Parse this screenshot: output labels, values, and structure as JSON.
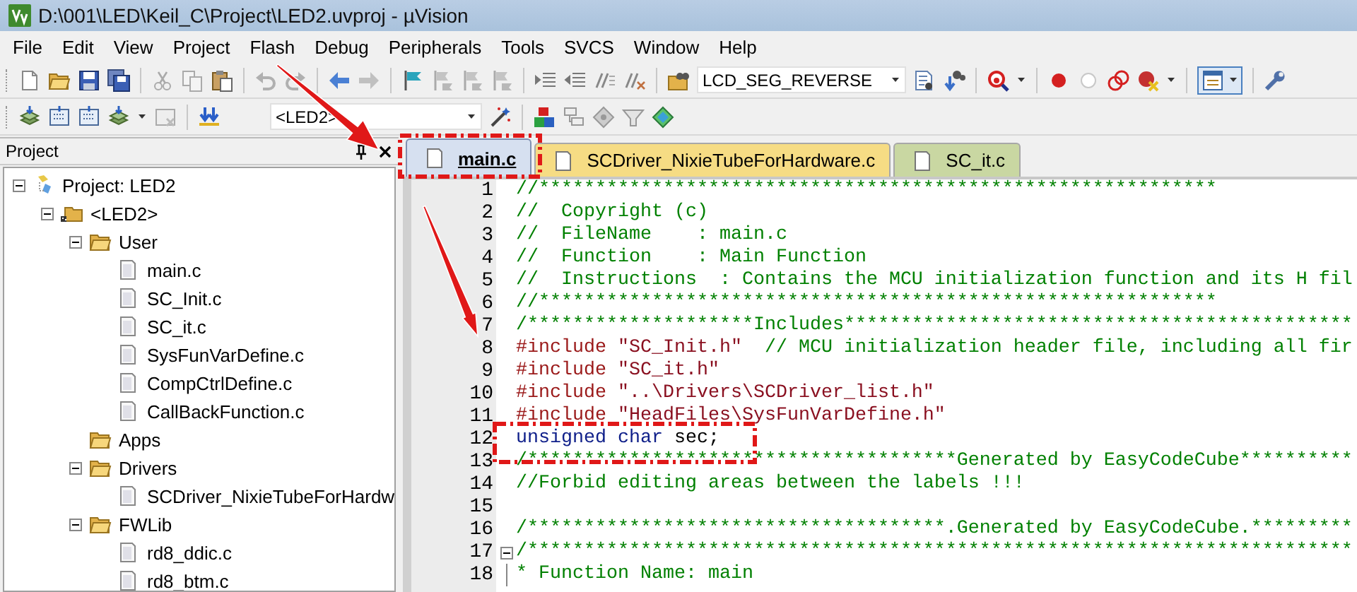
{
  "window": {
    "title": "D:\\001\\LED\\Keil_C\\Project\\LED2.uvproj - µVision"
  },
  "menu": [
    "File",
    "Edit",
    "View",
    "Project",
    "Flash",
    "Debug",
    "Peripherals",
    "Tools",
    "SVCS",
    "Window",
    "Help"
  ],
  "toolbar": {
    "find_combo": "LCD_SEG_REVERSE",
    "target_combo": "<LED2>"
  },
  "project_panel": {
    "title": "Project",
    "tree": [
      {
        "label": "Project: LED2",
        "kind": "project",
        "expanded": true,
        "children": [
          {
            "label": "<LED2>",
            "kind": "target",
            "expanded": true,
            "children": [
              {
                "label": "User",
                "kind": "group",
                "expanded": true,
                "children": [
                  {
                    "label": "main.c",
                    "kind": "file"
                  },
                  {
                    "label": "SC_Init.c",
                    "kind": "file"
                  },
                  {
                    "label": "SC_it.c",
                    "kind": "file"
                  },
                  {
                    "label": "SysFunVarDefine.c",
                    "kind": "file"
                  },
                  {
                    "label": "CompCtrlDefine.c",
                    "kind": "file"
                  },
                  {
                    "label": "CallBackFunction.c",
                    "kind": "file"
                  }
                ]
              },
              {
                "label": "Apps",
                "kind": "group"
              },
              {
                "label": "Drivers",
                "kind": "group",
                "expanded": true,
                "children": [
                  {
                    "label": "SCDriver_NixieTubeForHardw",
                    "kind": "file"
                  }
                ]
              },
              {
                "label": "FWLib",
                "kind": "group",
                "expanded": true,
                "children": [
                  {
                    "label": "rd8_ddic.c",
                    "kind": "file"
                  },
                  {
                    "label": "rd8_btm.c",
                    "kind": "file"
                  }
                ]
              }
            ]
          }
        ]
      }
    ]
  },
  "editor": {
    "tabs": [
      {
        "label": "main.c",
        "selected": true,
        "color": "#d6e0f0"
      },
      {
        "label": "SCDriver_NixieTubeForHardware.c",
        "selected": false,
        "color": "#f6dc84"
      },
      {
        "label": "SC_it.c",
        "selected": false,
        "color": "#c9d7a2"
      }
    ],
    "lines": [
      {
        "number": "1",
        "fold": false,
        "tokens": [
          {
            "kind": "comment",
            "text": "//************************************************************"
          }
        ]
      },
      {
        "number": "2",
        "fold": false,
        "tokens": [
          {
            "kind": "comment",
            "text": "//  Copyright (c)"
          }
        ]
      },
      {
        "number": "3",
        "fold": false,
        "tokens": [
          {
            "kind": "comment",
            "text": "//  FileName    : main.c"
          }
        ]
      },
      {
        "number": "4",
        "fold": false,
        "tokens": [
          {
            "kind": "comment",
            "text": "//  Function    : Main Function"
          }
        ]
      },
      {
        "number": "5",
        "fold": false,
        "tokens": [
          {
            "kind": "comment",
            "text": "//  Instructions  : Contains the MCU initialization function and its H fil"
          }
        ]
      },
      {
        "number": "6",
        "fold": false,
        "tokens": [
          {
            "kind": "comment",
            "text": "//************************************************************"
          }
        ]
      },
      {
        "number": "7",
        "fold": false,
        "tokens": [
          {
            "kind": "comment",
            "text": "/********************Includes*********************************************"
          }
        ]
      },
      {
        "number": "8",
        "fold": false,
        "tokens": [
          {
            "kind": "preproc",
            "text": "#include "
          },
          {
            "kind": "string",
            "text": "\"SC_Init.h\""
          },
          {
            "kind": "comment",
            "text": "  // MCU initialization header file, including all fir"
          }
        ]
      },
      {
        "number": "9",
        "fold": false,
        "tokens": [
          {
            "kind": "preproc",
            "text": "#include "
          },
          {
            "kind": "string",
            "text": "\"SC_it.h\""
          }
        ]
      },
      {
        "number": "10",
        "fold": false,
        "tokens": [
          {
            "kind": "preproc",
            "text": "#include "
          },
          {
            "kind": "string",
            "text": "\"..\\Drivers\\SCDriver_list.h\""
          }
        ]
      },
      {
        "number": "11",
        "fold": false,
        "tokens": [
          {
            "kind": "preproc",
            "text": "#include "
          },
          {
            "kind": "string",
            "text": "\"HeadFiles\\SysFunVarDefine.h\""
          }
        ]
      },
      {
        "number": "12",
        "fold": false,
        "tokens": [
          {
            "kind": "keyword",
            "text": "unsigned char"
          },
          {
            "kind": "plain",
            "text": " sec;"
          }
        ]
      },
      {
        "number": "13",
        "fold": false,
        "tokens": [
          {
            "kind": "comment",
            "text": "/**************************************Generated by EasyCodeCube**********"
          }
        ]
      },
      {
        "number": "14",
        "fold": false,
        "tokens": [
          {
            "kind": "comment",
            "text": "//Forbid editing areas between the labels !!!"
          }
        ]
      },
      {
        "number": "15",
        "fold": false
      },
      {
        "number": "16",
        "fold": false,
        "tokens": [
          {
            "kind": "comment",
            "text": "/*************************************.Generated by EasyCodeCube.*********"
          }
        ]
      },
      {
        "number": "17",
        "fold": true,
        "tokens": [
          {
            "kind": "comment",
            "text": "/*************************************************************************"
          }
        ]
      },
      {
        "number": "18",
        "fold": false,
        "tokens": [
          {
            "kind": "comment",
            "text": "* Function Name: main"
          }
        ]
      }
    ]
  }
}
